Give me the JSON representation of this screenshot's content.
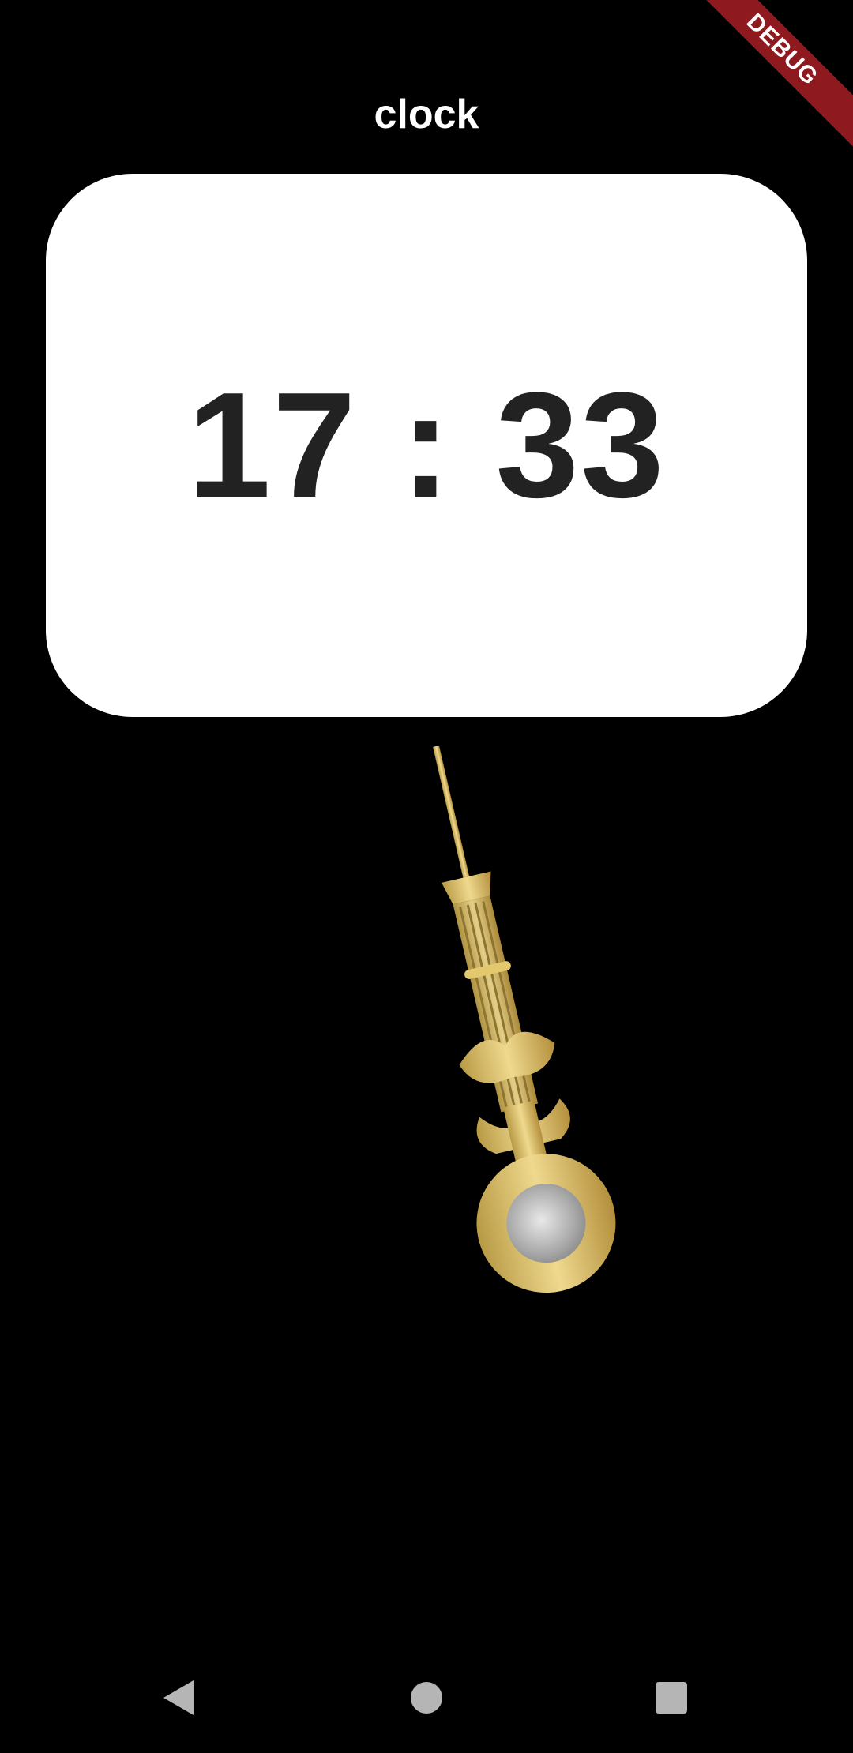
{
  "app": {
    "title": "clock",
    "debug_label": "DEBUG"
  },
  "clock": {
    "time": "17 : 33"
  },
  "pendulum": {
    "icon": "pendulum-icon",
    "color": "#D9C06A"
  },
  "nav": {
    "back_icon": "back-triangle-icon",
    "home_icon": "home-circle-icon",
    "recent_icon": "recent-square-icon"
  },
  "colors": {
    "background": "#000000",
    "card": "#FFFFFF",
    "time_text": "#222222",
    "debug_banner": "#8E1A1F"
  }
}
